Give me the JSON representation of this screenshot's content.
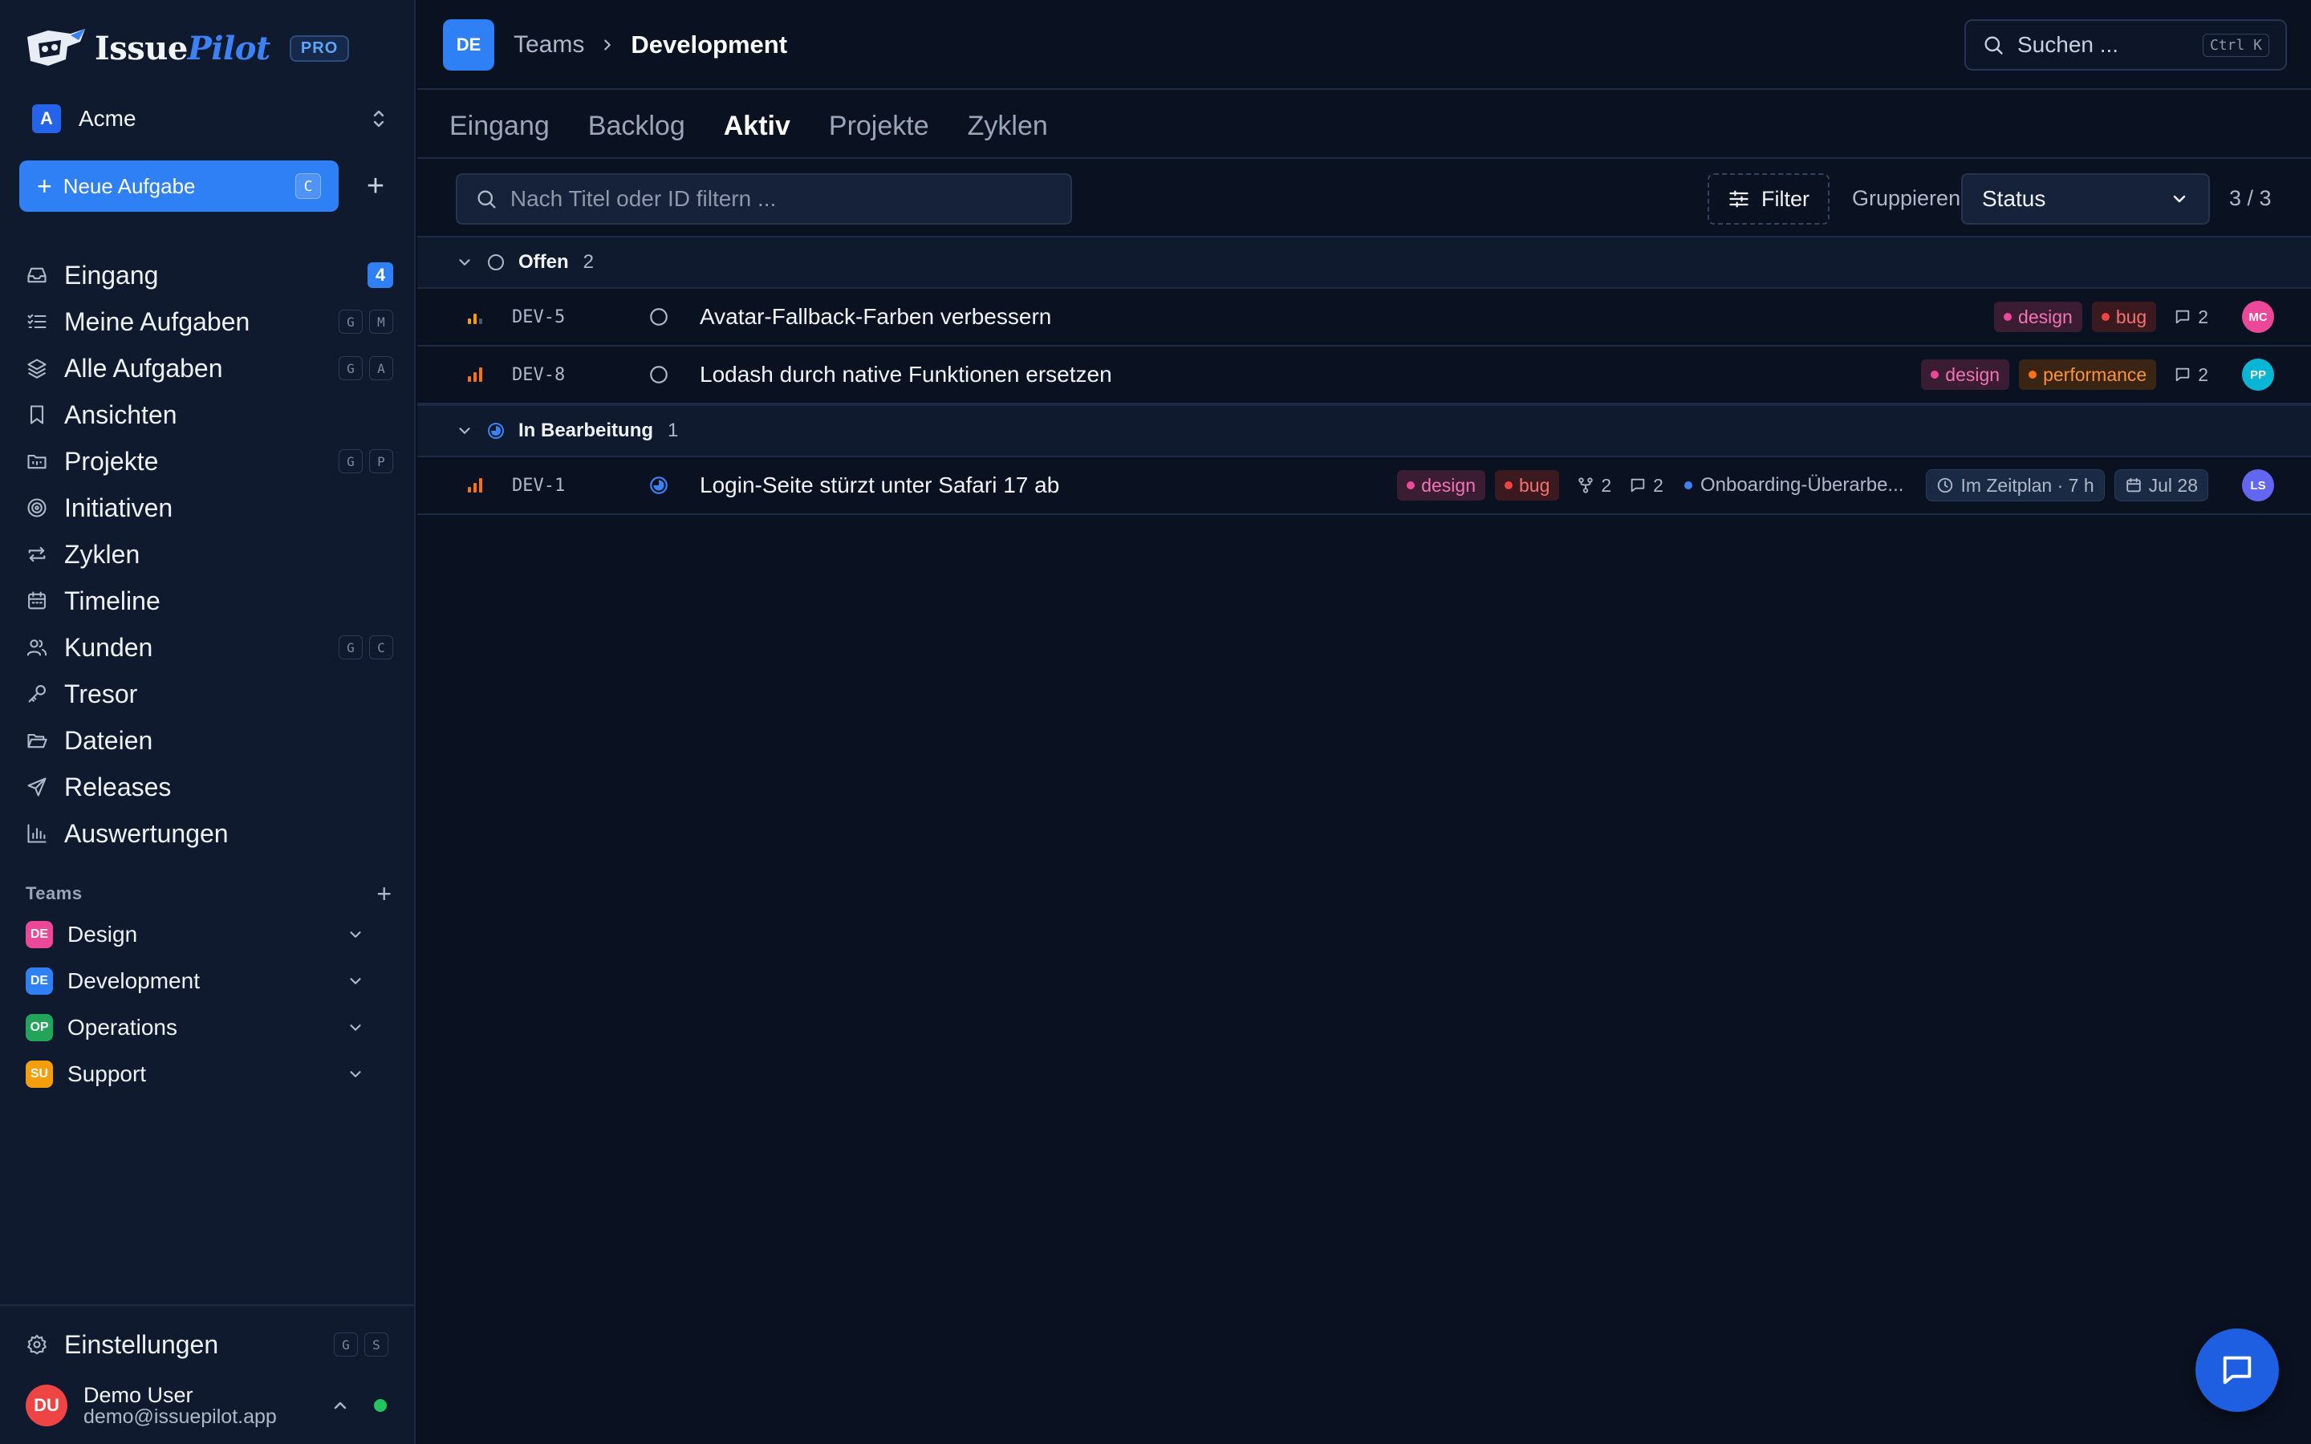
{
  "app": {
    "name_part1": "Issue",
    "name_part2": "Pilot",
    "badge": "PRO",
    "workspace_initial": "A",
    "workspace_name": "Acme"
  },
  "sidebar": {
    "new_task_label": "Neue Aufgabe",
    "new_task_key": "C",
    "items": [
      {
        "label": "Eingang",
        "icon": "inbox-icon",
        "count": "4"
      },
      {
        "label": "Meine Aufgaben",
        "icon": "list-check-icon",
        "keys": [
          "G",
          "M"
        ]
      },
      {
        "label": "Alle Aufgaben",
        "icon": "layers-icon",
        "keys": [
          "G",
          "A"
        ]
      },
      {
        "label": "Ansichten",
        "icon": "bookmark-icon"
      },
      {
        "label": "Projekte",
        "icon": "folder-kanban-icon",
        "keys": [
          "G",
          "P"
        ]
      },
      {
        "label": "Initiativen",
        "icon": "target-icon"
      },
      {
        "label": "Zyklen",
        "icon": "repeat-icon"
      },
      {
        "label": "Timeline",
        "icon": "calendar-icon"
      },
      {
        "label": "Kunden",
        "icon": "users-icon",
        "keys": [
          "G",
          "C"
        ]
      },
      {
        "label": "Tresor",
        "icon": "key-icon"
      },
      {
        "label": "Dateien",
        "icon": "folder-open-icon"
      },
      {
        "label": "Releases",
        "icon": "send-icon"
      },
      {
        "label": "Auswertungen",
        "icon": "bar-chart-icon"
      }
    ],
    "teams_label": "Teams",
    "teams": [
      {
        "initials": "DE",
        "name": "Design",
        "color": "#ec4899"
      },
      {
        "initials": "DE",
        "name": "Development",
        "color": "#2f7ff5"
      },
      {
        "initials": "OP",
        "name": "Operations",
        "color": "#22a55a"
      },
      {
        "initials": "SU",
        "name": "Support",
        "color": "#f59e0b"
      }
    ],
    "settings_label": "Einstellungen",
    "settings_keys": [
      "G",
      "S"
    ],
    "user": {
      "initials": "DU",
      "name": "Demo User",
      "email": "demo@issuepilot.app"
    }
  },
  "header": {
    "team_initials": "DE",
    "breadcrumb_parent": "Teams",
    "breadcrumb_current": "Development",
    "search_placeholder": "Suchen ...",
    "search_shortcut": "Ctrl K"
  },
  "tabs": [
    {
      "label": "Eingang",
      "active": false
    },
    {
      "label": "Backlog",
      "active": false
    },
    {
      "label": "Aktiv",
      "active": true
    },
    {
      "label": "Projekte",
      "active": false
    },
    {
      "label": "Zyklen",
      "active": false
    }
  ],
  "filters": {
    "search_placeholder": "Nach Titel oder ID filtern ...",
    "filter_label": "Filter",
    "group_label": "Gruppieren",
    "group_value": "Status",
    "count": "3 / 3"
  },
  "groups": [
    {
      "name": "Offen",
      "count": "2",
      "status": "open",
      "issues": [
        {
          "id": "DEV-5",
          "priority": "medium",
          "title": "Avatar-Fallback-Farben verbessern",
          "tags": [
            "design",
            "bug"
          ],
          "comments": "2",
          "assignee": "MC",
          "assignee_color": "#ec4899"
        },
        {
          "id": "DEV-8",
          "priority": "high",
          "title": "Lodash durch native Funktionen ersetzen",
          "tags": [
            "design",
            "performance"
          ],
          "comments": "2",
          "assignee": "PP",
          "assignee_color": "#06b6d4"
        }
      ]
    },
    {
      "name": "In Bearbeitung",
      "count": "1",
      "status": "in-progress",
      "issues": [
        {
          "id": "DEV-1",
          "priority": "high",
          "title": "Login-Seite stürzt unter Safari 17 ab",
          "tags": [
            "design",
            "bug"
          ],
          "subissues": "2",
          "comments": "2",
          "project": "Onboarding-Überarbe...",
          "schedule": "Im Zeitplan · 7 h",
          "due": "Jul 28",
          "assignee": "LS",
          "assignee_color": "#6366f1"
        }
      ]
    }
  ]
}
